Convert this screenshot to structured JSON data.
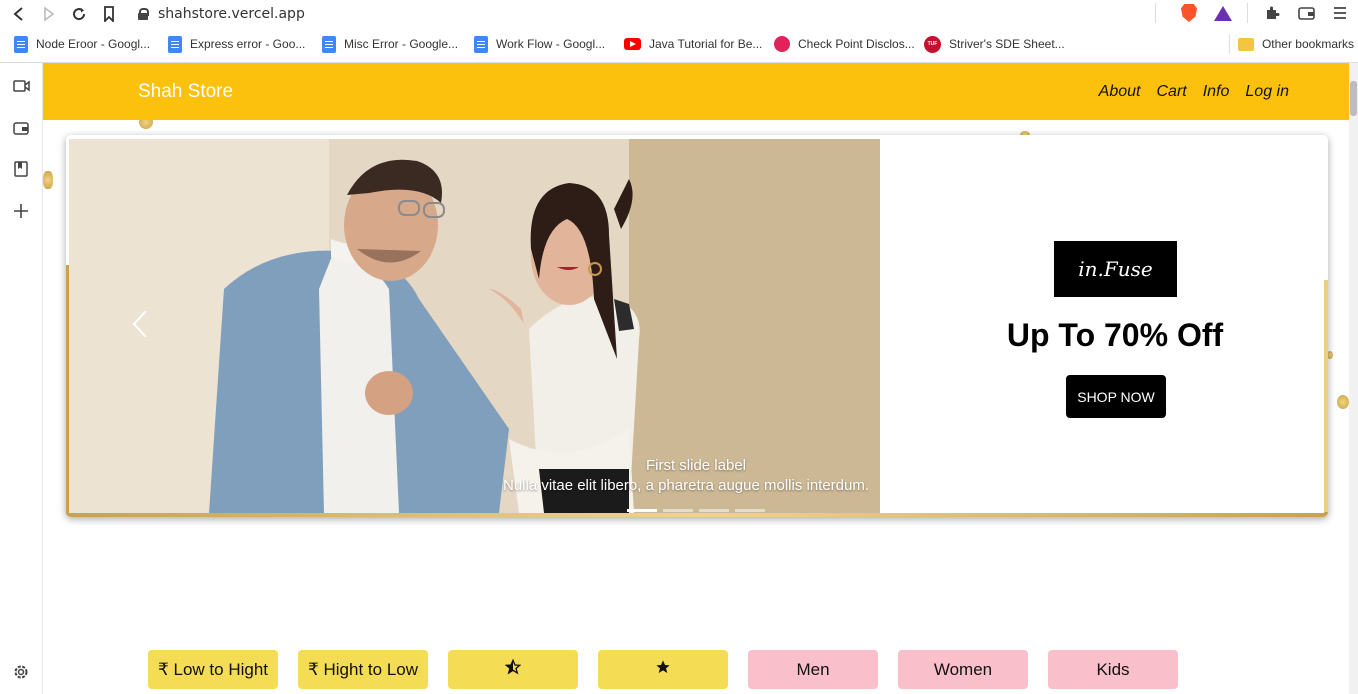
{
  "browser": {
    "url": "shahstore.vercel.app",
    "bookmarks": [
      {
        "label": "Node Eroor - Googl...",
        "icon": "google-docs-icon"
      },
      {
        "label": "Express error - Goo...",
        "icon": "google-docs-icon"
      },
      {
        "label": "Misc Error - Google...",
        "icon": "google-docs-icon"
      },
      {
        "label": "Work Flow - Googl...",
        "icon": "google-docs-icon"
      },
      {
        "label": "Java Tutorial for Be...",
        "icon": "youtube-icon"
      },
      {
        "label": "Check Point Disclos...",
        "icon": "checkpoint-icon"
      },
      {
        "label": "Striver's SDE Sheet...",
        "icon": "tuf-icon"
      }
    ],
    "other_bookmarks": "Other bookmarks",
    "tuf_badge": "TUF"
  },
  "store": {
    "brand": "Shah Store",
    "nav_links": [
      "About",
      "Cart",
      "Info",
      "Log in"
    ],
    "carousel": {
      "caption_title": "First slide label",
      "caption_text": "Nulla vitae elit libero, a pharetra augue mollis interdum.",
      "promo_logo": "in.Fuse",
      "promo_title": "Up To 70% Off",
      "promo_button": "SHOP NOW",
      "slide_count": 4,
      "active_slide": 1
    },
    "filters": [
      {
        "label": "₹ Low to Hight",
        "color": "#f5dc55"
      },
      {
        "label": "₹ Hight to Low",
        "color": "#f5dc55"
      },
      {
        "label": "☆★",
        "color": "#f5dc55"
      },
      {
        "label": "★",
        "color": "#f5dc55"
      },
      {
        "label": "Men",
        "color": "#f9c0cb"
      },
      {
        "label": "Women",
        "color": "#f9c0cb"
      },
      {
        "label": "Kids",
        "color": "#f9c0cb"
      }
    ]
  },
  "colors": {
    "navbar": "#fcc10c",
    "filter_yellow": "#f5dc55",
    "filter_pink": "#f9c0cb"
  }
}
